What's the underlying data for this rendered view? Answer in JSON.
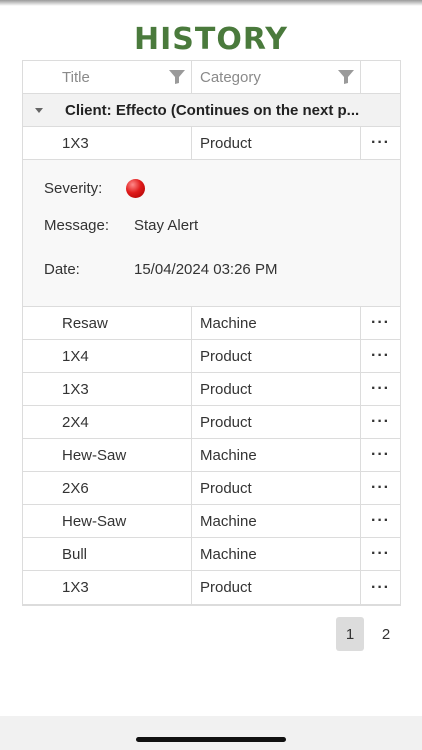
{
  "page": {
    "title": "HISTORY"
  },
  "columns": {
    "title": "Title",
    "category": "Category"
  },
  "group": {
    "label": "Client: Effecto (Continues on the next p..."
  },
  "expanded_row": {
    "title": "1X3",
    "category": "Product",
    "actions": "···"
  },
  "detail": {
    "severity_label": "Severity:",
    "severity_color": "#e01b1b",
    "message_label": "Message:",
    "message_value": "Stay Alert",
    "date_label": "Date:",
    "date_value": "15/04/2024 03:26 PM"
  },
  "rows": [
    {
      "title": "Resaw",
      "category": "Machine",
      "actions": "···"
    },
    {
      "title": "1X4",
      "category": "Product",
      "actions": "···"
    },
    {
      "title": "1X3",
      "category": "Product",
      "actions": "···"
    },
    {
      "title": "2X4",
      "category": "Product",
      "actions": "···"
    },
    {
      "title": "Hew-Saw",
      "category": "Machine",
      "actions": "···"
    },
    {
      "title": "2X6",
      "category": "Product",
      "actions": "···"
    },
    {
      "title": "Hew-Saw",
      "category": "Machine",
      "actions": "···"
    },
    {
      "title": "Bull",
      "category": "Machine",
      "actions": "···"
    },
    {
      "title": "1X3",
      "category": "Product",
      "actions": "···"
    }
  ],
  "pager": {
    "pages": [
      "1",
      "2"
    ],
    "current": "1"
  }
}
